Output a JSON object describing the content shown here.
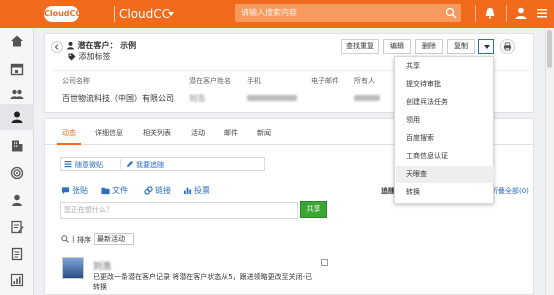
{
  "topbar": {
    "logo": "CloudCC",
    "app_name": "CloudCC",
    "search_placeholder": "请输入搜索内容"
  },
  "record": {
    "object_label": "潜在客户：",
    "name": "示例",
    "add_tag": "添加标签"
  },
  "actions": {
    "dedupe": "查找重复",
    "edit": "编辑",
    "delete": "删除",
    "copy": "复制"
  },
  "fields": {
    "company_label": "公司名称",
    "company_value": "百世物流科技（中国）有限公司",
    "lead_name_label": "潜在客户姓名",
    "lead_name_value": "刘浩",
    "phone_label": "手机",
    "email_label": "电子邮件",
    "owner_label": "所有人"
  },
  "tabs": [
    "动态",
    "详细信息",
    "相关列表",
    "活动",
    "邮件",
    "新闻"
  ],
  "pills": {
    "follow_weibo": "随意微贴",
    "my_follow": "我要追随"
  },
  "post_types": {
    "post": "张贴",
    "file": "文件",
    "link": "链接",
    "vote": "投票"
  },
  "composer": {
    "placeholder": "您正在想什么？",
    "share": "共享"
  },
  "side": {
    "follow_partial": "追随",
    "collapse_all": "折叠全部(0)"
  },
  "sort": {
    "label": "排序",
    "value": "最新活动"
  },
  "feed": {
    "name": "刘浩",
    "text": "已更改一条潜在客户记录 将潜在客户状态从5，跟进领略更改至关闭-已转换"
  },
  "dropdown": {
    "items": [
      "共享",
      "提交待审批",
      "创建兵法任务",
      "领用",
      "百度搜索",
      "工商信息认证",
      "天眼查",
      "转换"
    ],
    "highlighted_index": 6
  },
  "colors": {
    "brand": "#f26b1d",
    "link": "#2b6ec2",
    "share_green": "#3aa635"
  }
}
